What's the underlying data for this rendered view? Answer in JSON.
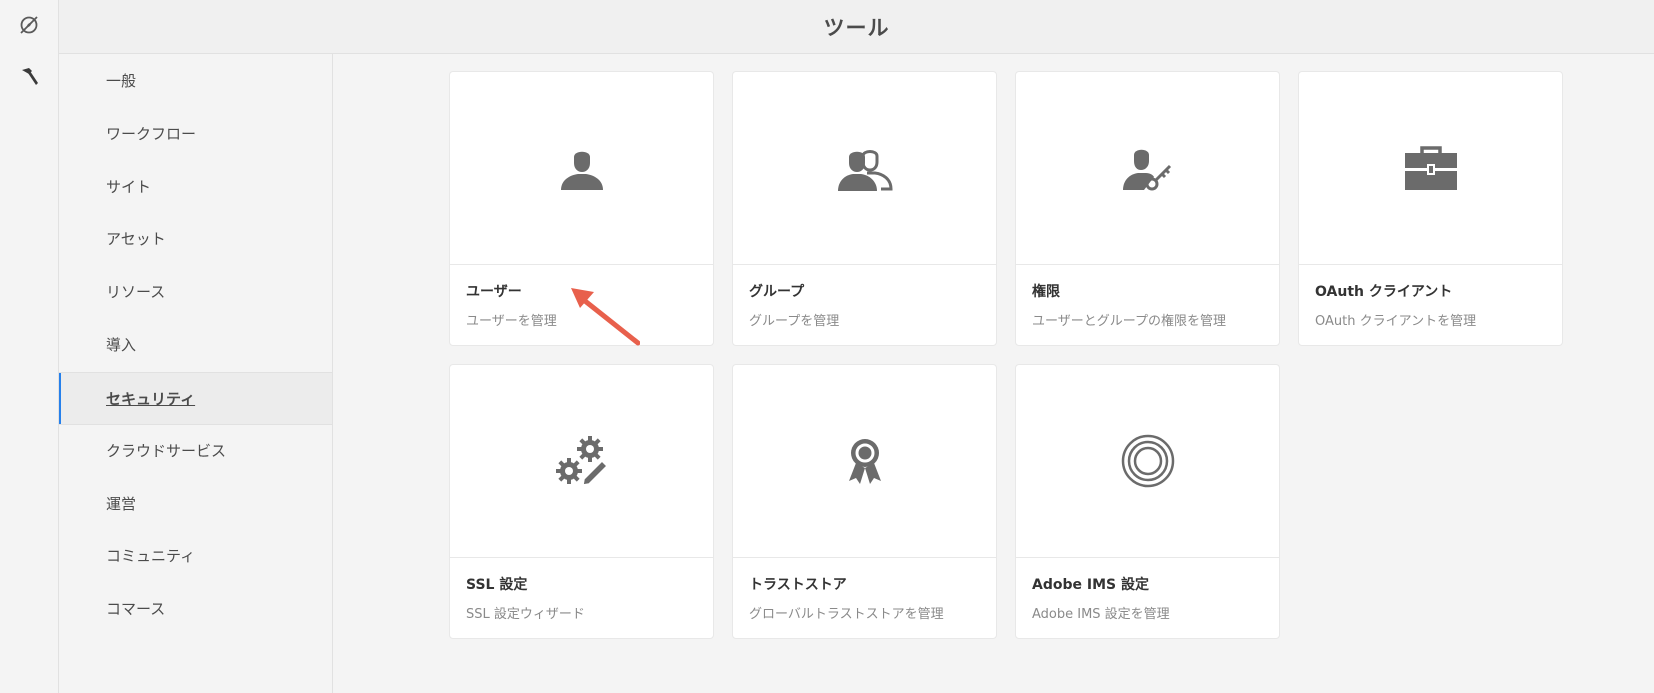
{
  "header": {
    "title": "ツール"
  },
  "rail": {
    "items": [
      {
        "icon": "navigation-compass-icon"
      },
      {
        "icon": "hammer-icon"
      }
    ]
  },
  "nav": {
    "items": [
      {
        "label": "一般"
      },
      {
        "label": "ワークフロー"
      },
      {
        "label": "サイト"
      },
      {
        "label": "アセット"
      },
      {
        "label": "リソース"
      },
      {
        "label": "導入"
      },
      {
        "label": "セキュリティ",
        "active": true
      },
      {
        "label": "クラウドサービス"
      },
      {
        "label": "運営"
      },
      {
        "label": "コミュニティ"
      },
      {
        "label": "コマース"
      }
    ]
  },
  "cards": [
    {
      "title": "ユーザー",
      "desc": "ユーザーを管理",
      "icon": "user-icon"
    },
    {
      "title": "グループ",
      "desc": "グループを管理",
      "icon": "users-group-icon"
    },
    {
      "title": "権限",
      "desc": "ユーザーとグループの権限を管理",
      "icon": "user-key-icon"
    },
    {
      "title": "OAuth クライアント",
      "desc": "OAuth クライアントを管理",
      "icon": "briefcase-icon"
    },
    {
      "title": "SSL 設定",
      "desc": "SSL 設定ウィザード",
      "icon": "gears-pencil-icon"
    },
    {
      "title": "トラストストア",
      "desc": "グローバルトラストストアを管理",
      "icon": "award-ribbon-icon"
    },
    {
      "title": "Adobe IMS 設定",
      "desc": "Adobe IMS 設定を管理",
      "icon": "target-rings-icon"
    }
  ],
  "colors": {
    "icon": "#6b6b6b",
    "accent": "#2680eb",
    "annotation_arrow": "#e8604c"
  }
}
